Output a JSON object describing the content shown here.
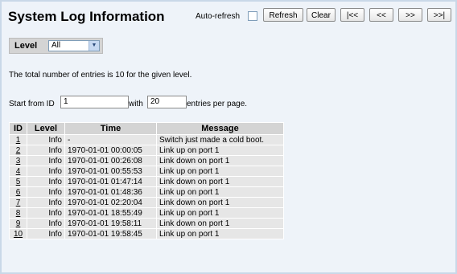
{
  "page": {
    "title": "System Log Information"
  },
  "controls": {
    "auto_refresh_label": "Auto-refresh",
    "buttons": [
      "Refresh",
      "Clear",
      "|<<",
      "<<",
      ">>",
      ">>|"
    ]
  },
  "filter": {
    "label": "Level",
    "selected": "All"
  },
  "summary": "The total number of entries is 10 for the given level.",
  "paging": {
    "start_label": "Start from ID",
    "start_value": "1",
    "with_label": "with",
    "count_value": "20",
    "per_page_label": "entries per page."
  },
  "table": {
    "headers": [
      "ID",
      "Level",
      "Time",
      "Message"
    ],
    "rows": [
      {
        "id": "1",
        "level": "Info",
        "time": "-",
        "message": "Switch just made a cold boot."
      },
      {
        "id": "2",
        "level": "Info",
        "time": "1970-01-01 00:00:05",
        "message": "Link up on port 1"
      },
      {
        "id": "3",
        "level": "Info",
        "time": "1970-01-01 00:26:08",
        "message": "Link down on port 1"
      },
      {
        "id": "4",
        "level": "Info",
        "time": "1970-01-01 00:55:53",
        "message": "Link up on port 1"
      },
      {
        "id": "5",
        "level": "Info",
        "time": "1970-01-01 01:47:14",
        "message": "Link down on port 1"
      },
      {
        "id": "6",
        "level": "Info",
        "time": "1970-01-01 01:48:36",
        "message": "Link up on port 1"
      },
      {
        "id": "7",
        "level": "Info",
        "time": "1970-01-01 02:20:04",
        "message": "Link down on port 1"
      },
      {
        "id": "8",
        "level": "Info",
        "time": "1970-01-01 18:55:49",
        "message": "Link up on port 1"
      },
      {
        "id": "9",
        "level": "Info",
        "time": "1970-01-01 19:58:11",
        "message": "Link down on port 1"
      },
      {
        "id": "10",
        "level": "Info",
        "time": "1970-01-01 19:58:45",
        "message": "Link up on port 1"
      }
    ]
  }
}
